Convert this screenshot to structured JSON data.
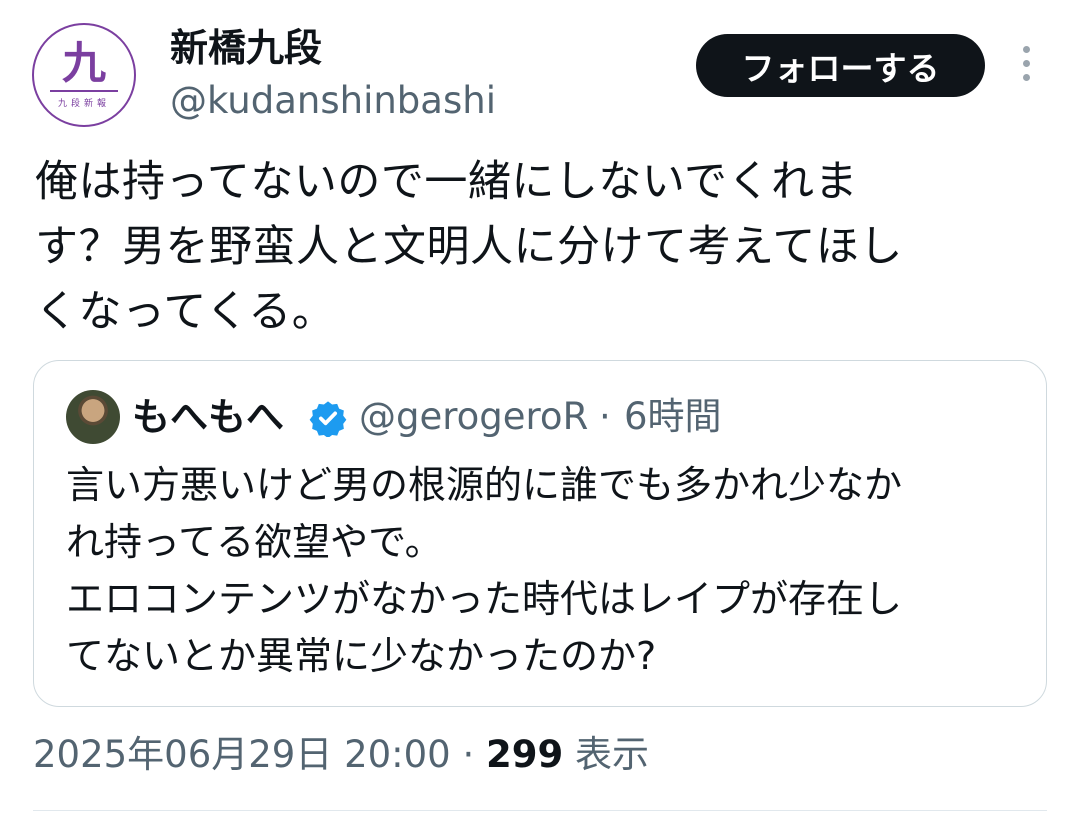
{
  "author": {
    "avatar_main": "九",
    "avatar_sub": "九段新報",
    "display_name": "新橋九段",
    "handle": "@kudanshinbashi"
  },
  "follow_label": "フォローする",
  "tweet_text": "俺は持ってないので一緒にしないでくれま\nす？男を野蛮人と文明人に分けて考えてほし\nくなってくる。",
  "quote": {
    "display_name": "もへもへ",
    "handle": "@gerogeroR",
    "separator": "·",
    "time": "6時間",
    "text": "言い方悪いけど男の根源的に誰でも多かれ少なか\nれ持ってる欲望やで。\nエロコンテンツがなかった時代はレイプが存在し\nてないとか異常に少なかったのか?"
  },
  "meta": {
    "timestamp": "2025年06月29日 20:00",
    "separator": " · ",
    "views_count": "299",
    "views_label": " 表示"
  },
  "colors": {
    "accent_purple": "#7b3fa0",
    "verified_blue": "#1d9bf0",
    "button_dark": "#0f1419",
    "secondary_text": "#536471"
  }
}
